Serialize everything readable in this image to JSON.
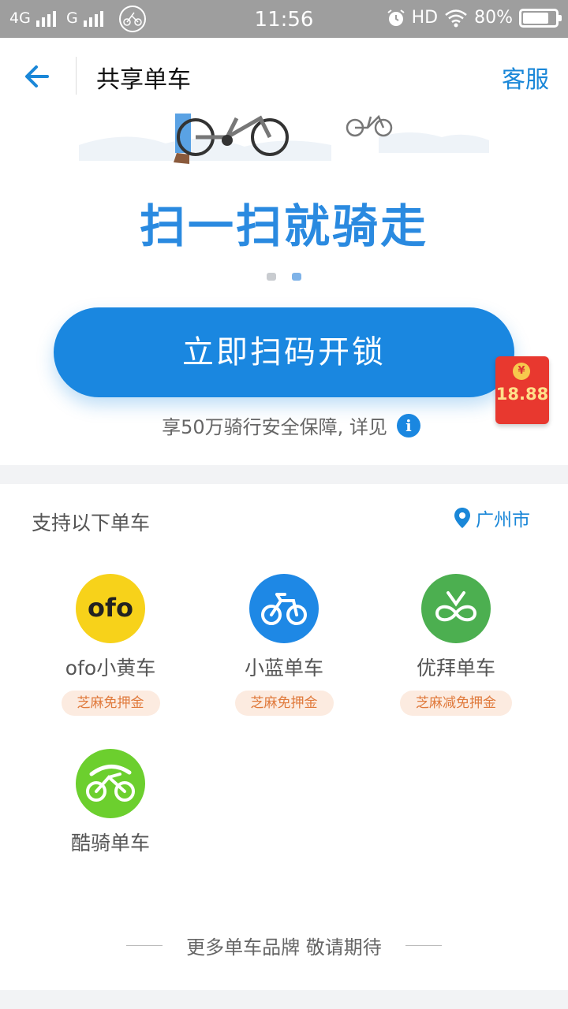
{
  "status_bar": {
    "network_1": "4G",
    "network_2": "G",
    "time": "11:56",
    "hd": "HD",
    "battery_percent": "80%",
    "battery_level": 0.8
  },
  "header": {
    "title": "共享单车",
    "service_label": "客服"
  },
  "banner": {
    "slogan": "扫一扫就骑走",
    "page_count": 2,
    "active_page": 2
  },
  "scan_button": {
    "label": "立即扫码开锁"
  },
  "safety_note": {
    "text": "享50万骑行安全保障, 详见"
  },
  "red_packet": {
    "amount": "18.88",
    "currency_symbol": "¥"
  },
  "supported": {
    "title": "支持以下单车",
    "city": "广州市",
    "brands": [
      {
        "name": "ofo小黄车",
        "tag": "芝麻免押金",
        "logo_text": "ofo",
        "color": "#f7d21a"
      },
      {
        "name": "小蓝单车",
        "tag": "芝麻免押金",
        "color": "#1e88e5"
      },
      {
        "name": "优拜单车",
        "tag": "芝麻减免押金",
        "color": "#4caf50"
      },
      {
        "name": "酷骑单车",
        "tag": "",
        "color": "#6ccf2e"
      }
    ],
    "more_text": "更多单车品牌 敬请期待"
  },
  "colors": {
    "accent": "#1a87e0",
    "status_bar": "#9e9e9e",
    "tag_bg": "#fcebe0",
    "tag_text": "#e07a3c"
  }
}
